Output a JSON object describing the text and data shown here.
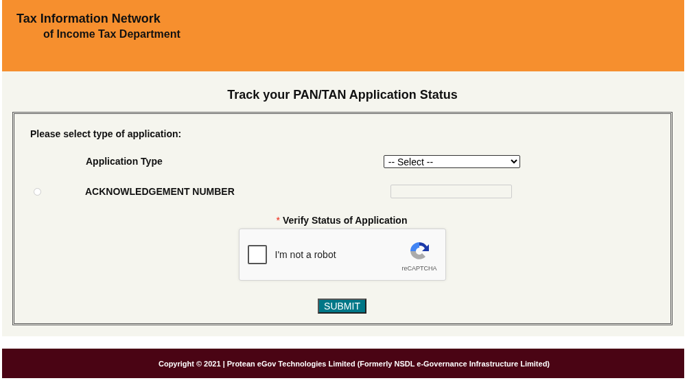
{
  "header": {
    "title": "Tax Information Network",
    "subtitle": "of Income Tax Department"
  },
  "page_title": "Track your PAN/TAN Application Status",
  "form": {
    "prompt": "Please select type of application:",
    "application_type": {
      "label": "Application Type",
      "value": "-- Select --"
    },
    "acknowledgement": {
      "label": "ACKNOWLEDGEMENT NUMBER",
      "selected": false
    },
    "verify": {
      "required_mark": "*",
      "label": "Verify Status of Application"
    },
    "captcha": {
      "label": "I'm not a robot",
      "checked": false,
      "brand": "reCAPTCHA"
    },
    "submit_button": "SUBMIT"
  },
  "footer": {
    "copyright": "Copyright © 2021 | Protean eGov Technologies Limited (Formerly NSDL e-Governance Infrastructure Limited)"
  }
}
